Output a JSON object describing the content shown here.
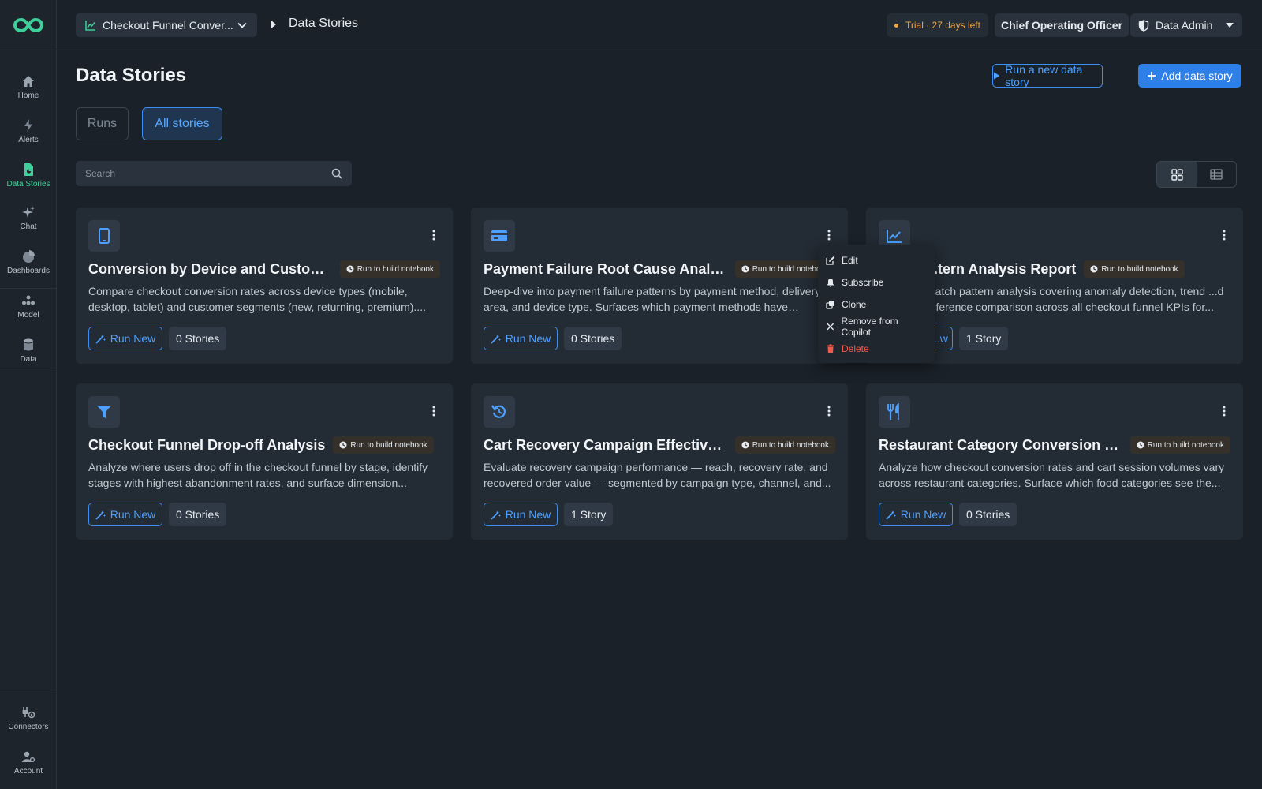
{
  "sidebar": {
    "items": [
      {
        "label": "Home",
        "icon": "home-icon"
      },
      {
        "label": "Alerts",
        "icon": "bolt-icon"
      },
      {
        "label": "Data Stories",
        "icon": "data-stories-icon"
      },
      {
        "label": "Chat",
        "icon": "sparkle-icon"
      },
      {
        "label": "Dashboards",
        "icon": "pie-chart-icon"
      },
      {
        "label": "Model",
        "icon": "model-icon"
      },
      {
        "label": "Data",
        "icon": "database-icon"
      }
    ],
    "bottom": [
      {
        "label": "Connectors",
        "icon": "connector-icon"
      },
      {
        "label": "Account",
        "icon": "account-icon"
      }
    ],
    "active": "Data Stories",
    "accent": "#3ecf9a"
  },
  "topbar": {
    "model_name": "Checkout Funnel Conver...",
    "breadcrumb": "Data Stories",
    "trial": "Trial · 27 days left",
    "role": "Chief Operating Officer",
    "admin": "Data Admin"
  },
  "page": {
    "title": "Data Stories",
    "run_new_label": "Run a new data story",
    "add_label": "Add data story",
    "tabs": [
      {
        "label": "Runs"
      },
      {
        "label": "All stories"
      }
    ],
    "active_tab": "All stories",
    "search_placeholder": "Search"
  },
  "cards": [
    {
      "icon": "phone-icon",
      "title": "Conversion by Device and Customer ...",
      "badge": "Run to build notebook",
      "desc": "Compare checkout conversion rates across device types (mobile, desktop, tablet) and customer segments (new, returning, premium)....",
      "run": "Run New",
      "stories": "0 Stories"
    },
    {
      "icon": "credit-card-icon",
      "title": "Payment Failure Root Cause Analysis",
      "badge": "Run to build notebook",
      "desc": "Deep-dive into payment failure patterns by payment method, delivery area, and device type. Surfaces which payment methods have highest...",
      "run": "Run New",
      "stories": "0 Stories"
    },
    {
      "icon": "line-chart-icon",
      "title": "...tern Analysis Report",
      "badge": "Run to build notebook",
      "desc": "...atch pattern analysis covering anomaly detection, trend ...d reference comparison across all checkout funnel KPIs for...",
      "run": "...w",
      "stories": "1 Story"
    },
    {
      "icon": "filter-icon",
      "title": "Checkout Funnel Drop-off Analysis",
      "badge": "Run to build notebook",
      "desc": "Analyze where users drop off in the checkout funnel by stage, identify stages with highest abandonment rates, and surface dimension...",
      "run": "Run New",
      "stories": "0 Stories"
    },
    {
      "icon": "refresh-icon",
      "title": "Cart Recovery Campaign Effectiven...",
      "badge": "Run to build notebook",
      "desc": "Evaluate recovery campaign performance — reach, recovery rate, and recovered order value — segmented by campaign type, channel, and...",
      "run": "Run New",
      "stories": "1 Story"
    },
    {
      "icon": "utensils-icon",
      "title": "Restaurant Category Conversion Tre...",
      "badge": "Run to build notebook",
      "desc": "Analyze how checkout conversion rates and cart session volumes vary across restaurant categories. Surface which food categories see the...",
      "run": "Run New",
      "stories": "0 Stories"
    }
  ],
  "context_menu": {
    "items": [
      {
        "label": "Edit",
        "icon": "edit-icon"
      },
      {
        "label": "Subscribe",
        "icon": "bell-icon"
      },
      {
        "label": "Clone",
        "icon": "clone-icon"
      },
      {
        "label": "Remove from Copilot",
        "icon": "close-icon"
      },
      {
        "label": "Delete",
        "icon": "trash-icon",
        "danger": true
      }
    ]
  },
  "colors": {
    "background": "#1a2129",
    "card": "#232b34",
    "primary": "#2f7fe8",
    "link": "#4da0ff",
    "warning": "#f0a742",
    "danger": "#ef5b4c"
  }
}
